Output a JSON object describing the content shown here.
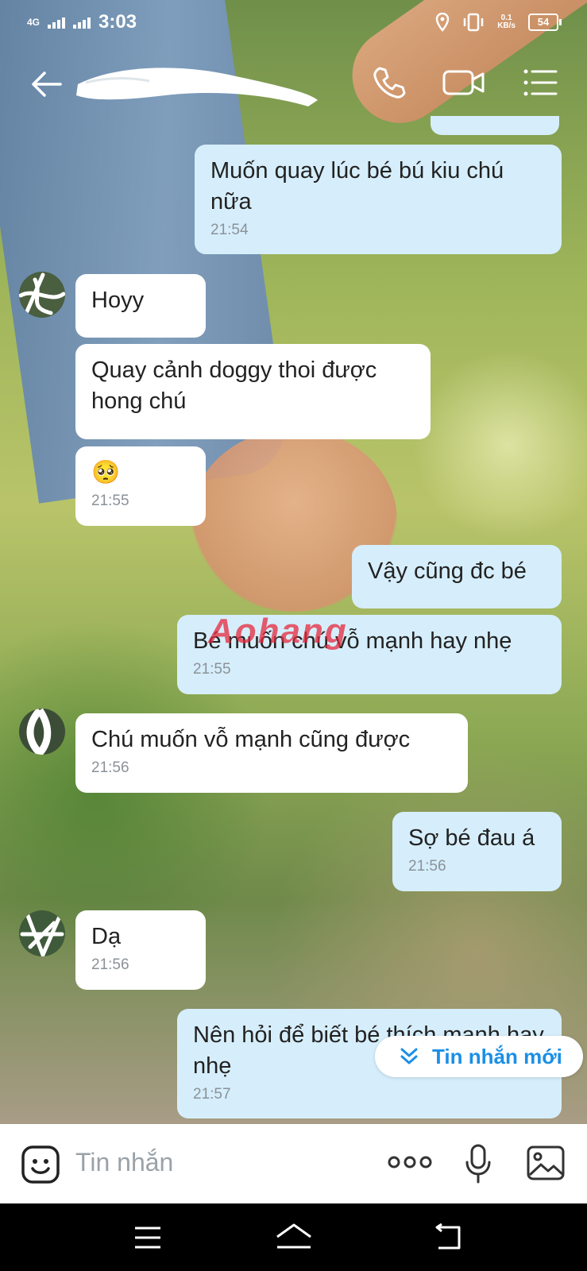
{
  "status_bar": {
    "network": "4G",
    "time": "3:03",
    "speed_value": "0.1",
    "speed_unit": "KB/s",
    "battery": "54"
  },
  "header": {
    "contact_name_redacted": true
  },
  "messages": [
    {
      "side": "out",
      "text": "Muốn quay lúc bé bú kiu chú nữa",
      "time": "21:54"
    },
    {
      "side": "in",
      "text": "Hoyy",
      "time": ""
    },
    {
      "side": "in",
      "text": "Quay cảnh doggy thoi được hong chú",
      "time": ""
    },
    {
      "side": "in",
      "text": "🥺",
      "time": "21:55"
    },
    {
      "side": "out",
      "text": "Vậy cũng đc bé",
      "time": ""
    },
    {
      "side": "out",
      "text": "Bé muốn chú vỗ mạnh hay nhẹ",
      "time": "21:55"
    },
    {
      "side": "in",
      "text": "Chú muốn vỗ mạnh cũng được",
      "time": "21:56"
    },
    {
      "side": "out",
      "text": "Sợ bé đau á",
      "time": "21:56"
    },
    {
      "side": "in",
      "text": "Dạ",
      "time": "21:56"
    },
    {
      "side": "out",
      "text": "Nên hỏi để biết bé thích mạnh hay nhẹ",
      "time": "21:57"
    }
  ],
  "watermark": "Aohang",
  "new_messages_label": "Tin nhắn mới",
  "composer": {
    "placeholder": "Tin nhắn"
  },
  "colors": {
    "incoming_bubble": "#ffffff",
    "outgoing_bubble": "#d6eefb",
    "accent": "#1b8fe6"
  }
}
